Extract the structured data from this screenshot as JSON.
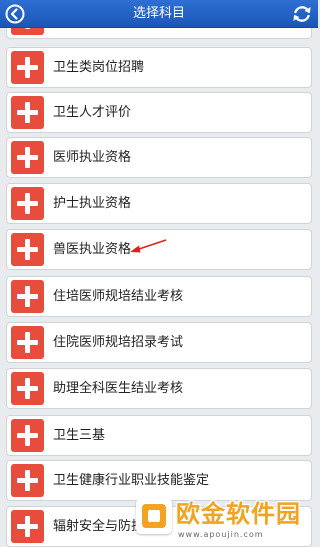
{
  "header": {
    "title": "选择科目",
    "back_icon": "back-arrow-icon",
    "refresh_icon": "refresh-icon"
  },
  "items": [
    {
      "label": "卫生类岗位招聘"
    },
    {
      "label": "卫生人才评价"
    },
    {
      "label": "医师执业资格"
    },
    {
      "label": "护士执业资格"
    },
    {
      "label": "兽医执业资格"
    },
    {
      "label": "住培医师规培结业考核"
    },
    {
      "label": "住院医师规培招录考试"
    },
    {
      "label": "助理全科医生结业考核"
    },
    {
      "label": "卫生三基"
    },
    {
      "label": "卫生健康行业职业技能鉴定"
    },
    {
      "label": "辐射安全与防护考核"
    }
  ],
  "watermark": {
    "title": "欧金软件园",
    "url": "www.apoujin.com"
  },
  "colors": {
    "header": "#1f5fc8",
    "plus_button": "#e74c3c",
    "background": "#e9ecef",
    "annotation_arrow": "#e02020"
  }
}
